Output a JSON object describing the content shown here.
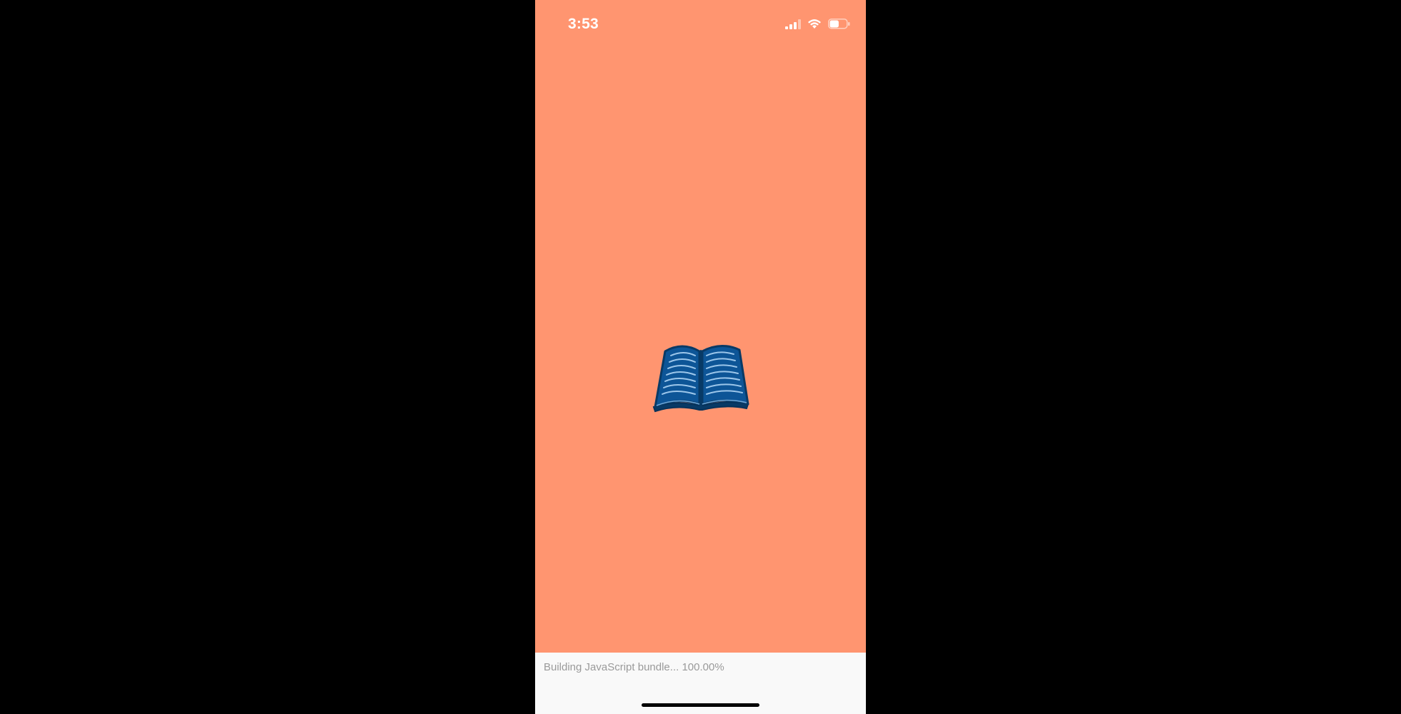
{
  "status_bar": {
    "time": "3:53",
    "icons": [
      "cellular-signal-icon",
      "wifi-icon",
      "battery-icon"
    ],
    "battery_level": 0.55
  },
  "splash": {
    "background_color": "#ff9570",
    "logo_icon": "open-book-icon",
    "logo_color": "#0b4a82"
  },
  "dev_footer": {
    "bundle_status": "Building JavaScript bundle... 100.00%",
    "background_color": "#f9f9f9"
  }
}
